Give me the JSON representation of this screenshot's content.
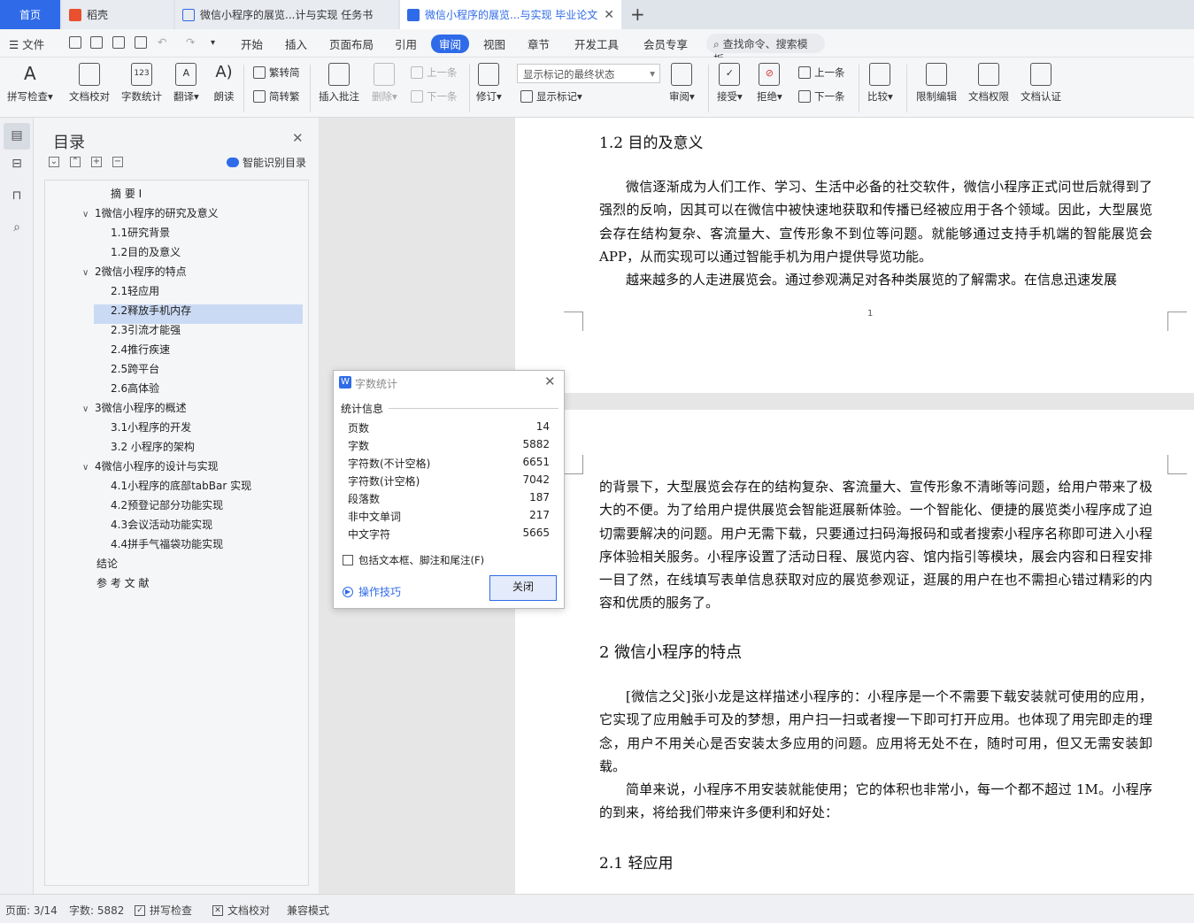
{
  "tabs": {
    "home": "首页",
    "daoke": "稻壳",
    "doc1": "微信小程序的展览...计与实现 任务书",
    "doc2": "微信小程序的展览...与实现 毕业论文"
  },
  "menu": {
    "file": "文件",
    "items": [
      "开始",
      "插入",
      "页面布局",
      "引用",
      "审阅",
      "视图",
      "章节",
      "开发工具",
      "会员专享"
    ],
    "search": "查找命令、搜索模板"
  },
  "ribbon": {
    "spellcheck": "拼写检查",
    "proofread": "文档校对",
    "wordcount": "字数统计",
    "translate": "翻译",
    "read_aloud": "朗读",
    "trad_to_simp": "繁转简",
    "simp_to_trad": "简转繁",
    "insert_comment": "插入批注",
    "delete": "删除",
    "prev_comment": "上一条",
    "next_comment": "下一条",
    "track_changes": "修订",
    "markup_mode": "显示标记的最终状态",
    "show_markup": "显示标记",
    "review_pane": "审阅",
    "accept": "接受",
    "reject": "拒绝",
    "prev_change": "上一条",
    "next_change": "下一条",
    "compare": "比较",
    "restrict_editing": "限制编辑",
    "doc_permission": "文档权限",
    "doc_cert": "文档认证"
  },
  "toc": {
    "title": "目录",
    "smart": "智能识别目录",
    "items": [
      "摘 要 Ⅰ",
      "1微信小程序的研究及意义",
      "1.1研究背景",
      "1.2目的及意义",
      "2微信小程序的特点",
      "2.1轻应用",
      "2.2释放手机内存",
      "2.3引流才能强",
      "2.4推行疾速",
      "2.5跨平台",
      "2.6高体验",
      "3微信小程序的概述",
      "3.1小程序的开发",
      "3.2 小程序的架构",
      "4微信小程序的设计与实现",
      "4.1小程序的底部tabBar 实现",
      "4.2预登记部分功能实现",
      "4.3会议活动功能实现",
      "4.4拼手气福袋功能实现",
      "结论",
      "参 考 文 献"
    ]
  },
  "doc": {
    "h12": "1.2  目的及意义",
    "p1": "微信逐渐成为人们工作、学习、生活中必备的社交软件，微信小程序正式问世后就得到了强烈的反响，因其可以在微信中被快速地获取和传播已经被应用于各个领域。因此，大型展览会存在结构复杂、客流量大、宣传形象不到位等问题。就能够通过支持手机端的智能展览会 APP，从而实现可以通过智能手机为用户提供导览功能。",
    "p2": "越来越多的人走进展览会。通过参观满足对各种类展览的了解需求。在信息迅速发展",
    "pagenum": "1",
    "p3": "的背景下，大型展览会存在的结构复杂、客流量大、宣传形象不清晰等问题，给用户带来了极大的不便。为了给用户提供展览会智能逛展新体验。一个智能化、便捷的展览类小程序成了迫切需要解决的问题。用户无需下载，只要通过扫码海报码和或者搜索小程序名称即可进入小程序体验相关服务。小程序设置了活动日程、展览内容、馆内指引等模块，展会内容和日程安排一目了然，在线填写表单信息获取对应的展览参观证，逛展的用户在也不需担心错过精彩的内容和优质的服务了。",
    "h2": "2  微信小程序的特点",
    "p4": "[微信之父]张小龙是这样描述小程序的：小程序是一个不需要下载安装就可使用的应用，它实现了应用触手可及的梦想，用户扫一扫或者搜一下即可打开应用。也体现了用完即走的理念，用户不用关心是否安装太多应用的问题。应用将无处不在，随时可用，但又无需安装卸载。",
    "p5": "简单来说，小程序不用安装就能使用；它的体积也非常小，每一个都不超过 1M。小程序的到来，将给我们带来许多便利和好处：",
    "h21": "2.1  轻应用"
  },
  "dialog": {
    "title": "字数统计",
    "section": "统计信息",
    "stats": [
      {
        "label": "页数",
        "value": "14"
      },
      {
        "label": "字数",
        "value": "5882"
      },
      {
        "label": "字符数(不计空格)",
        "value": "6651"
      },
      {
        "label": "字符数(计空格)",
        "value": "7042"
      },
      {
        "label": "段落数",
        "value": "187"
      },
      {
        "label": "非中文单词",
        "value": "217"
      },
      {
        "label": "中文字符",
        "value": "5665"
      }
    ],
    "include": "包括文本框、脚注和尾注(F)",
    "tips": "操作技巧",
    "close": "关闭"
  },
  "status": {
    "page": "页面: 3/14",
    "words": "字数: 5882",
    "spell": "拼写检查",
    "proof": "文档校对",
    "compat": "兼容模式"
  },
  "colors": {
    "accent": "#2f6be8",
    "selection": "#cbdaf4"
  }
}
